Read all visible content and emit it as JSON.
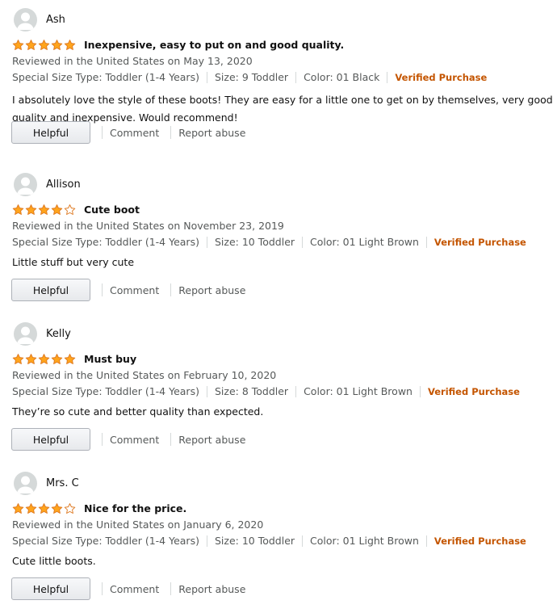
{
  "reviews": [
    {
      "name": "Ash",
      "rating": 5,
      "title": "Inexpensive, easy to put on and good quality.",
      "date": "Reviewed in the United States on May 13, 2020",
      "size_type": "Special Size Type: Toddler (1-4 Years)",
      "size": "Size: 9 Toddler",
      "color": "Color: 01 Black",
      "verified": "Verified Purchase",
      "body": "I absolutely love the style of these boots! They are easy for a little one to get on by themselves, very good quality and inexpensive. Would recommend!",
      "helpful": "Helpful",
      "comment": "Comment",
      "report": "Report abuse"
    },
    {
      "name": "Allison",
      "rating": 4,
      "title": "Cute boot",
      "date": "Reviewed in the United States on November 23, 2019",
      "size_type": "Special Size Type: Toddler (1-4 Years)",
      "size": "Size: 10 Toddler",
      "color": "Color: 01 Light Brown",
      "verified": "Verified Purchase",
      "body": "Little stuff but very cute",
      "helpful": "Helpful",
      "comment": "Comment",
      "report": "Report abuse"
    },
    {
      "name": "Kelly",
      "rating": 5,
      "title": "Must buy",
      "date": "Reviewed in the United States on February 10, 2020",
      "size_type": "Special Size Type: Toddler (1-4 Years)",
      "size": "Size: 8 Toddler",
      "color": "Color: 01 Light Brown",
      "verified": "Verified Purchase",
      "body": "They’re so cute and better quality than expected.",
      "helpful": "Helpful",
      "comment": "Comment",
      "report": "Report abuse"
    },
    {
      "name": "Mrs. C",
      "rating": 4,
      "title": "Nice for the price.",
      "date": "Reviewed in the United States on January 6, 2020",
      "size_type": "Special Size Type: Toddler (1-4 Years)",
      "size": "Size: 10 Toddler",
      "color": "Color: 01 Light Brown",
      "verified": "Verified Purchase",
      "body": "Cute little boots.",
      "helpful": "Helpful",
      "comment": "Comment",
      "report": "Report abuse"
    }
  ],
  "colors": {
    "star": "#ffa41c",
    "star_stroke": "#de7921",
    "verified": "#c45500",
    "meta": "#565959"
  }
}
